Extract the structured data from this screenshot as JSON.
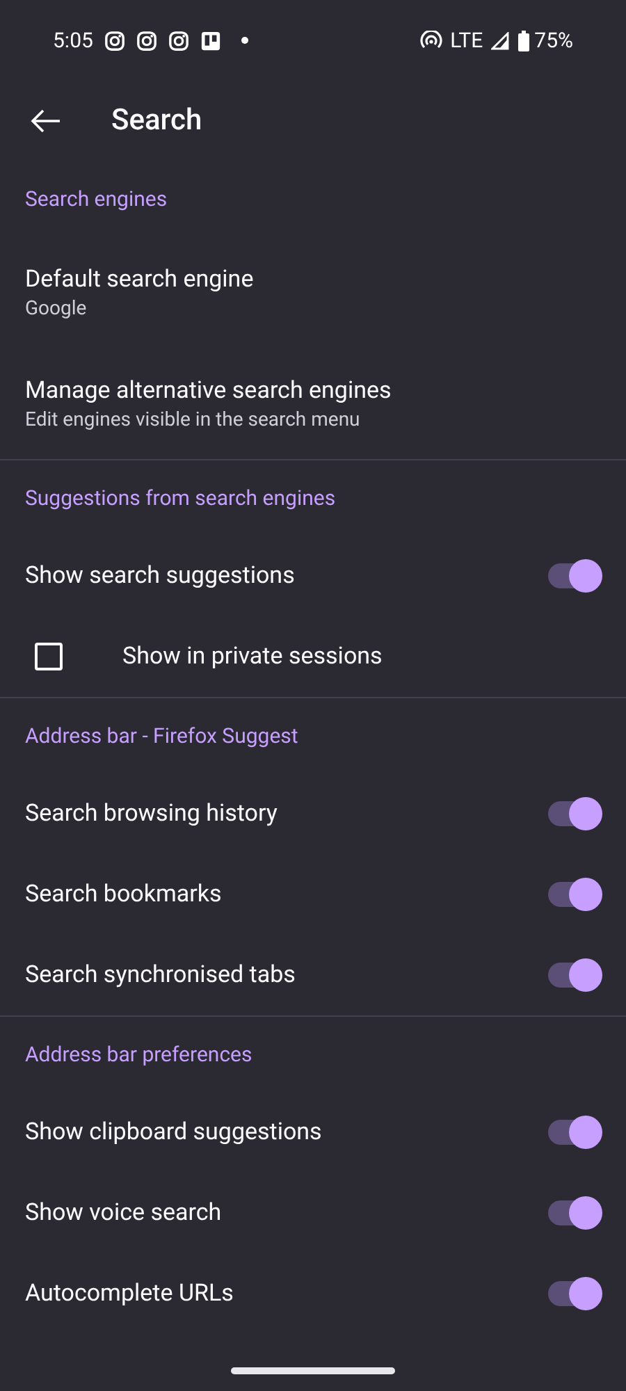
{
  "status_bar": {
    "time": "5:05",
    "network": "LTE",
    "battery": "75%"
  },
  "toolbar": {
    "title": "Search"
  },
  "sections": [
    {
      "title": "Search engines",
      "items": [
        {
          "kind": "nav",
          "label": "Default search engine",
          "sublabel": "Google"
        },
        {
          "kind": "nav",
          "label": "Manage alternative search engines",
          "sublabel": "Edit engines visible in the search menu"
        }
      ]
    },
    {
      "title": "Suggestions from search engines",
      "items": [
        {
          "kind": "toggle",
          "label": "Show search suggestions",
          "on": true
        },
        {
          "kind": "checkbox",
          "label": "Show in private sessions",
          "checked": false
        }
      ]
    },
    {
      "title": "Address bar - Firefox Suggest",
      "items": [
        {
          "kind": "toggle",
          "label": "Search browsing history",
          "on": true
        },
        {
          "kind": "toggle",
          "label": "Search bookmarks",
          "on": true
        },
        {
          "kind": "toggle",
          "label": "Search synchronised tabs",
          "on": true
        }
      ]
    },
    {
      "title": "Address bar preferences",
      "items": [
        {
          "kind": "toggle",
          "label": "Show clipboard suggestions",
          "on": true
        },
        {
          "kind": "toggle",
          "label": "Show voice search",
          "on": true
        },
        {
          "kind": "toggle",
          "label": "Autocomplete URLs",
          "on": true
        }
      ]
    }
  ]
}
